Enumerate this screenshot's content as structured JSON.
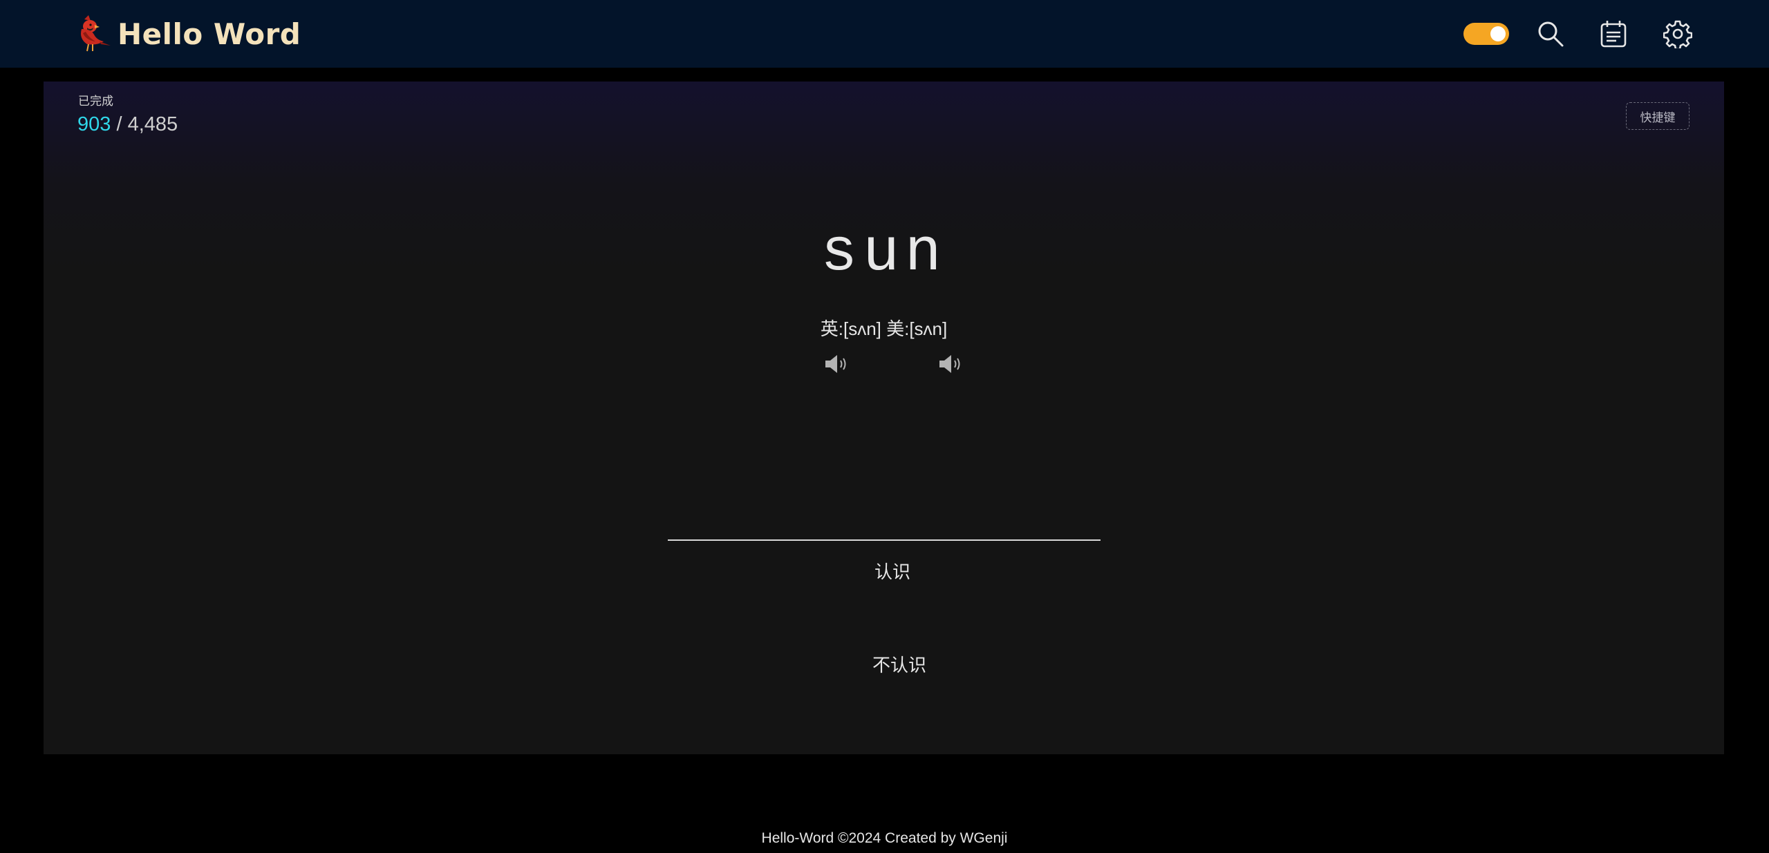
{
  "header": {
    "title": "Hello Word",
    "logo_icon": "cardinal-bird-icon",
    "theme_toggle_on": true,
    "accent_color": "#f5a623",
    "icons": [
      "search-icon",
      "calendar-icon",
      "gear-icon"
    ]
  },
  "progress": {
    "label": "已完成",
    "done": "903",
    "separator": " / ",
    "total": "4,485"
  },
  "shortcut_label": "快捷键",
  "word": {
    "text": "sun",
    "phonetic": "英:[sʌn] 美:[sʌn]"
  },
  "actions": {
    "know_label": "认识",
    "unknown_label": "不认识"
  },
  "footer": {
    "text": "Hello-Word ©2024 Created by WGenji"
  }
}
